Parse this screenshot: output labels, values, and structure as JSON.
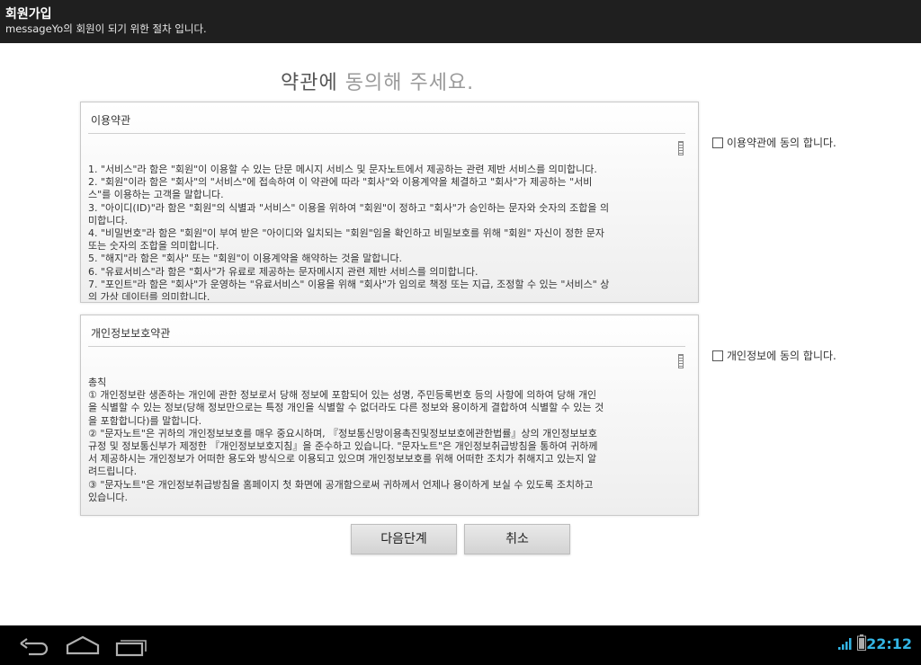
{
  "header": {
    "title": "회원가입",
    "subtitle": "messageYo의 회원이 되기 위한 절차 입니다."
  },
  "page": {
    "heading_dark": "약관에",
    "heading_light": "동의해 주세요."
  },
  "terms": {
    "title": "이용약관",
    "lines": [
      "1. \"서비스\"라 함은 \"회원\"이 이용할 수 있는 단문 메시지 서비스 및 문자노트에서 제공하는 관련 제반 서비스를 의미합니다.",
      "2. \"회원\"이라 함은 \"회사\"의 \"서비스\"에 접속하여 이 약관에 따라 \"회사\"와 이용계약을 체결하고 \"회사\"가 제공하는 \"서비",
      "스\"를 이용하는 고객을 말합니다.",
      "3. \"아이디(ID)\"라 함은 \"회원\"의 식별과 \"서비스\" 이용을 위하여 \"회원\"이 정하고 \"회사\"가 승인하는 문자와 숫자의 조합을 의",
      "미합니다.",
      "4. \"비밀번호\"라 함은 \"회원\"이 부여 받은 \"아이디와 일치되는 \"회원\"임을 확인하고 비밀보호를 위해 \"회원\" 자신이 정한 문자",
      "또는 숫자의 조합을 의미합니다.",
      "5. \"해지\"라 함은 \"회사\" 또는 \"회원\"이 이용계약을 해약하는 것을 말합니다.",
      "6. \"유료서비스\"라 함은 \"회사\"가 유료로 제공하는 문자메시지 관련 제반 서비스를 의미합니다.",
      "7. \"포인트\"라 함은 \"회사\"가 운영하는 \"유료서비스\" 이용을 위해 \"회사\"가 임의로 책정 또는 지급, 조정할 수 있는 \"서비스\" 상",
      "의 가상 데이터를 의미합니다."
    ],
    "agree_label": "이용약관에 동의 합니다."
  },
  "privacy": {
    "title": "개인정보보호약관",
    "lines": [
      "총칙",
      "",
      "① 개인정보란 생존하는 개인에 관한 정보로서 당해 정보에 포함되어 있는 성명, 주민등록번호 등의 사항에 의하여 당해 개인",
      "을 식별할 수 있는 정보(당해 정보만으로는 특정 개인을 식별할 수 없더라도 다른 정보와 용이하게 결합하여 식별할 수 있는 것",
      "을 포함합니다)를 말합니다.",
      "② \"문자노트\"은 귀하의 개인정보보호를 매우 중요시하며, 『정보통신망이용촉진및정보보호에관한법률』상의 개인정보보호",
      "규정 및 정보통신부가 제정한 『개인정보보호지침』을 준수하고 있습니다. \"문자노트\"은 개인정보취급방침을 통하여 귀하께",
      "서 제공하시는 개인정보가 어떠한 용도와 방식으로 이용되고 있으며 개인정보보호를 위해 어떠한 조치가 취해지고 있는지 알",
      "려드립니다.",
      "③ \"문자노트\"은 개인정보취급방침을 홈페이지 첫 화면에 공개함으로써 귀하께서 언제나 용이하게 보실 수 있도록 조치하고",
      "있습니다."
    ],
    "agree_label": "개인정보에 동의 합니다."
  },
  "buttons": {
    "next": "다음단계",
    "cancel": "취소"
  },
  "status": {
    "time": "22:12"
  },
  "nav_icons": [
    "back-icon",
    "home-icon",
    "recent-apps-icon"
  ],
  "status_icons": [
    "signal-icon",
    "battery-icon"
  ],
  "colors": {
    "title_bar": "#1f1f1f",
    "clock": "#33b5e5"
  }
}
